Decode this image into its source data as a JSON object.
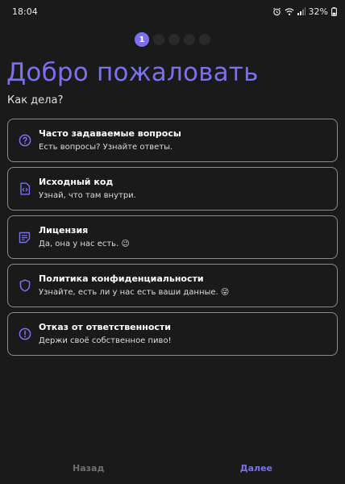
{
  "status_bar": {
    "time": "18:04",
    "battery": "32%",
    "icons": [
      "alarm-icon",
      "wifi-icon",
      "signal-icon",
      "battery-icon"
    ]
  },
  "pager": {
    "current": "1",
    "total": 5,
    "active_color": "#7c70f2"
  },
  "header": {
    "title": "Добро пожаловать",
    "subtitle": "Как дела?"
  },
  "cards": [
    {
      "title": "Часто задаваемые вопросы",
      "description": "Есть вопросы? Узнайте ответы.",
      "icon": "question-icon"
    },
    {
      "title": "Исходный код",
      "description": "Узнай, что там внутри.",
      "icon": "source-code-icon"
    },
    {
      "title": "Лицензия",
      "description": "Да, она у нас есть. 😉",
      "icon": "license-document-icon"
    },
    {
      "title": "Политика конфиденциальности",
      "description": "Узнайте, есть ли у нас есть ваши данные. 😜",
      "icon": "shield-icon"
    },
    {
      "title": "Отказ от ответственности",
      "description": "Держи своё собственное пиво!",
      "icon": "alert-icon"
    }
  ],
  "navigation": {
    "back_label": "Назад",
    "next_label": "Далее"
  },
  "colors": {
    "accent": "#7c70f2",
    "background": "#1b1a1b",
    "card_border": "#8b8b8b"
  }
}
